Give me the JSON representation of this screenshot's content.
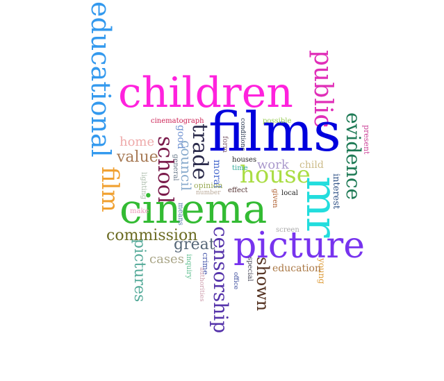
{
  "words": [
    {
      "key": "educational",
      "text": "educational",
      "color": "#3399ee"
    },
    {
      "key": "children",
      "text": "children",
      "color": "#ff22dd"
    },
    {
      "key": "public",
      "text": "public",
      "color": "#e02fb8"
    },
    {
      "key": "films",
      "text": "films",
      "color": "#0000dd"
    },
    {
      "key": "evidence",
      "text": "evidence",
      "color": "#1e7a55"
    },
    {
      "key": "present",
      "text": "present",
      "color": "#cc4499"
    },
    {
      "key": "cinematograph",
      "text": "cinematograph",
      "color": "#cc2255"
    },
    {
      "key": "good",
      "text": "good",
      "color": "#6b8fd0"
    },
    {
      "key": "trade",
      "text": "trade",
      "color": "#2b2b4b"
    },
    {
      "key": "conditions",
      "text": "conditions",
      "color": "#1a2a44"
    },
    {
      "key": "possible",
      "text": "possible",
      "color": "#99cc55"
    },
    {
      "key": "home",
      "text": "home",
      "color": "#eeaaaa"
    },
    {
      "key": "school",
      "text": "school",
      "color": "#7a1a4a"
    },
    {
      "key": "council",
      "text": "council",
      "color": "#88aacc"
    },
    {
      "key": "general",
      "text": "general",
      "color": "#667788"
    },
    {
      "key": "form",
      "text": "form",
      "color": "#7a5a6a"
    },
    {
      "key": "value",
      "text": "value",
      "color": "#a77a55"
    },
    {
      "key": "house",
      "text": "house",
      "color": "#aadd44"
    },
    {
      "key": "houses",
      "text": "houses",
      "color": "#222222"
    },
    {
      "key": "time",
      "text": "time",
      "color": "#33aa99"
    },
    {
      "key": "work",
      "text": "work",
      "color": "#aa99cc"
    },
    {
      "key": "child",
      "text": "child",
      "color": "#ccbb88"
    },
    {
      "key": "mr",
      "text": "mr",
      "color": "#22dddd"
    },
    {
      "key": "interest",
      "text": "interest",
      "color": "#335588"
    },
    {
      "key": "film",
      "text": "film",
      "color": "#f0a030"
    },
    {
      "key": "lighting",
      "text": "lighting",
      "color": "#aabbaa"
    },
    {
      "key": "moral",
      "text": "moral",
      "color": "#4466cc"
    },
    {
      "key": "opinion",
      "text": "opinion",
      "color": "#99aa55"
    },
    {
      "key": "effect",
      "text": "effect",
      "color": "#553333"
    },
    {
      "key": "local",
      "text": "local",
      "color": "#222222"
    },
    {
      "key": "number",
      "text": "number",
      "color": "#bbaa99"
    },
    {
      "key": "given",
      "text": "given",
      "color": "#aa5522"
    },
    {
      "key": "cinema",
      "text": "cinema",
      "color": "#33bb33"
    },
    {
      "key": "make",
      "text": "make",
      "color": "#ee99bb"
    },
    {
      "key": "means",
      "text": "means",
      "color": "#5577aa"
    },
    {
      "key": "commission",
      "text": "commission",
      "color": "#6b6b22"
    },
    {
      "key": "screen",
      "text": "screen",
      "color": "#aaaaaa"
    },
    {
      "key": "picture",
      "text": "picture",
      "color": "#7733ee"
    },
    {
      "key": "great",
      "text": "great",
      "color": "#556677"
    },
    {
      "key": "censorship",
      "text": "censorship",
      "color": "#5533aa"
    },
    {
      "key": "young",
      "text": "young",
      "color": "#dd9933"
    },
    {
      "key": "pictures",
      "text": "pictures",
      "color": "#55aa99"
    },
    {
      "key": "cases",
      "text": "cases",
      "color": "#aaa688"
    },
    {
      "key": "inquiry",
      "text": "inquiry",
      "color": "#55bb88"
    },
    {
      "key": "crime",
      "text": "crime",
      "color": "#4455aa"
    },
    {
      "key": "authorities",
      "text": "authorities",
      "color": "#cc99aa"
    },
    {
      "key": "special",
      "text": "special",
      "color": "#444455"
    },
    {
      "key": "office",
      "text": "office",
      "color": "#334499"
    },
    {
      "key": "shown",
      "text": "shown",
      "color": "#553322"
    },
    {
      "key": "education",
      "text": "education",
      "color": "#aa7744"
    }
  ]
}
